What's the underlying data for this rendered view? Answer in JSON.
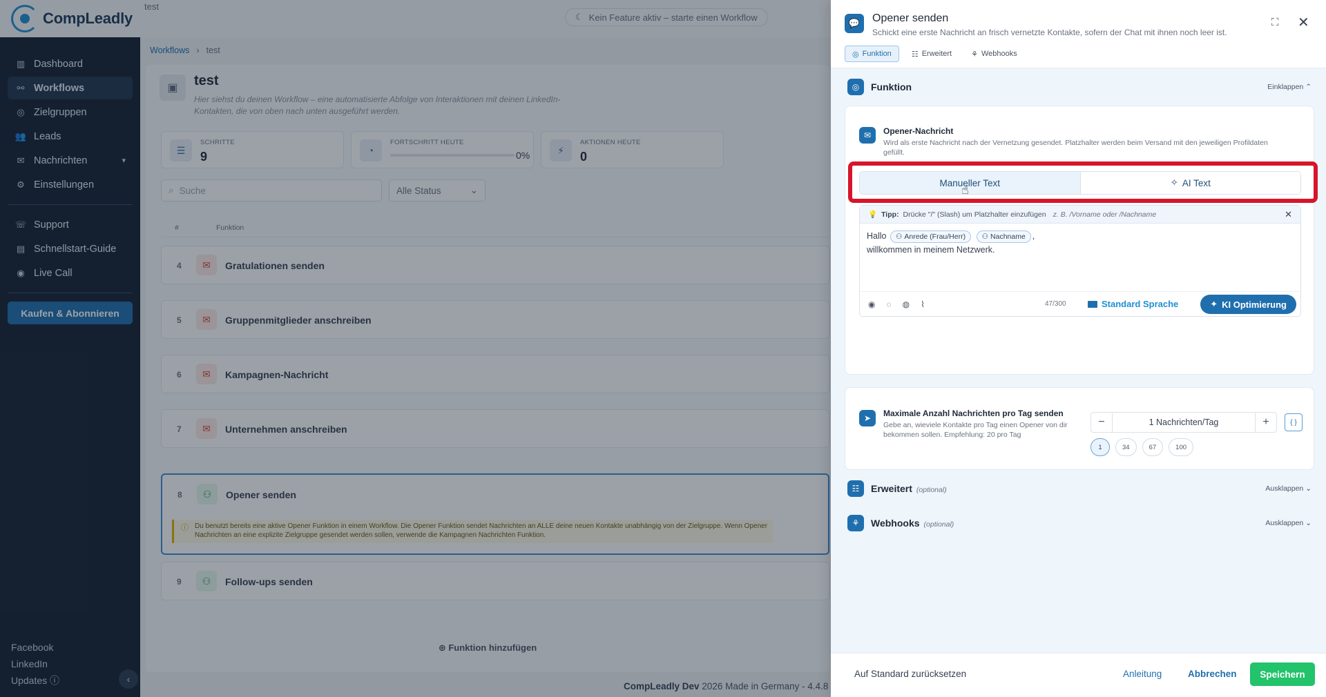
{
  "brand": {
    "name": "CompLeadly"
  },
  "topbar": {
    "breadcrumb_top": "test",
    "feature_status": "Kein Feature aktiv – starte einen Workflow"
  },
  "sidebar": {
    "items": [
      {
        "label": "Dashboard",
        "icon": "chart-icon"
      },
      {
        "label": "Workflows",
        "icon": "workflow-icon",
        "active": true
      },
      {
        "label": "Zielgruppen",
        "icon": "target-icon"
      },
      {
        "label": "Leads",
        "icon": "users-icon"
      },
      {
        "label": "Nachrichten",
        "icon": "message-icon"
      },
      {
        "label": "Einstellungen",
        "icon": "gear-icon"
      }
    ],
    "secondary": [
      {
        "label": "Support",
        "icon": "support-icon"
      },
      {
        "label": "Schnellstart-Guide",
        "icon": "book-icon"
      },
      {
        "label": "Live Call",
        "icon": "location-icon"
      }
    ],
    "buy_label": "Kaufen & Abonnieren",
    "bottom_links": [
      "Facebook",
      "LinkedIn",
      "Updates"
    ]
  },
  "breadcrumb": {
    "root": "Workflows",
    "current": "test"
  },
  "workflow": {
    "title": "test",
    "description": "Hier siehst du deinen Workflow – eine automatisierte Abfolge von Interaktionen mit deinen LinkedIn-Kontakten, die von oben nach unten ausgeführt werden.",
    "stats": {
      "steps": {
        "label": "SCHRITTE",
        "value": "9"
      },
      "progress": {
        "label": "FORTSCHRITT HEUTE",
        "value": "0%",
        "fraction": 0
      },
      "actions": {
        "label": "AKTIONEN HEUTE",
        "value": "0"
      }
    },
    "search_placeholder": "Suche",
    "status_filter": "Alle Status",
    "table_headers": {
      "num": "#",
      "function": "Funktion"
    },
    "rows": [
      {
        "num": "4",
        "name": "Gratulationen senden",
        "icon": "mail-icon"
      },
      {
        "num": "5",
        "name": "Gruppenmitglieder anschreiben",
        "icon": "mail-icon"
      },
      {
        "num": "6",
        "name": "Kampagnen-Nachricht",
        "icon": "mail-icon"
      },
      {
        "num": "7",
        "name": "Unternehmen anschreiben",
        "icon": "mail-icon"
      },
      {
        "num": "8",
        "name": "Opener senden",
        "icon": "user-plus-icon"
      },
      {
        "num": "9",
        "name": "Follow-ups senden",
        "icon": "user-plus-icon"
      }
    ],
    "warning": "Du benutzt bereits eine aktive Opener Funktion in einem Workflow. Die Opener Funktion sendet Nachrichten an ALLE deine neuen Kontakte unabhängig von der Zielgruppe. Wenn Opener Nachrichten an eine explizite Zielgruppe gesendet werden sollen, verwende die Kampagnen Nachrichten Funktion.",
    "add_function": "Funktion hinzufügen",
    "footer_brand": "CompLeadly Dev",
    "footer_text": "2026 Made in Germany - 4.4.8"
  },
  "drawer": {
    "title": "Opener senden",
    "subtitle": "Schickt eine erste Nachricht an frisch vernetzte Kontakte, sofern der Chat mit ihnen noch leer ist.",
    "tabs": [
      "Funktion",
      "Erweitert",
      "Webhooks"
    ],
    "section_function": {
      "title": "Funktion",
      "action": "Einklappen"
    },
    "opener": {
      "title": "Opener-Nachricht",
      "desc": "Wird als erste Nachricht nach der Vernetzung gesendet. Platzhalter werden beim Versand mit den jeweiligen Profildaten gefüllt.",
      "mode_manual": "Manueller Text",
      "mode_ai": "AI Text",
      "tip_label": "Tipp:",
      "tip_text": "Drücke \"/\" (Slash) um Platzhalter einzufügen",
      "tip_example": "z. B. /Vorname oder /Nachname",
      "text_greeting": "Hallo",
      "chip_salutation": "Anrede (Frau/Herr)",
      "chip_lastname": "Nachname",
      "text_comma": ",",
      "text_line2": "willkommen in meinem Netzwerk.",
      "char_count": "47/300",
      "language": "Standard Sprache",
      "ki_button": "KI Optimierung"
    },
    "limit": {
      "title": "Maximale Anzahl Nachrichten pro Tag senden",
      "desc": "Gebe an, wieviele Kontakte pro Tag einen Opener von dir bekommen sollen. Empfehlung: 20 pro Tag",
      "value": "1 Nachrichten/Tag",
      "presets": [
        "1",
        "34",
        "67",
        "100"
      ]
    },
    "section_advanced": {
      "title": "Erweitert",
      "optional": "(optional)",
      "action": "Ausklappen"
    },
    "section_webhooks": {
      "title": "Webhooks",
      "optional": "(optional)",
      "action": "Ausklappen"
    },
    "footer": {
      "reset": "Auf Standard zurücksetzen",
      "guide": "Anleitung",
      "cancel": "Abbrechen",
      "save": "Speichern"
    }
  }
}
